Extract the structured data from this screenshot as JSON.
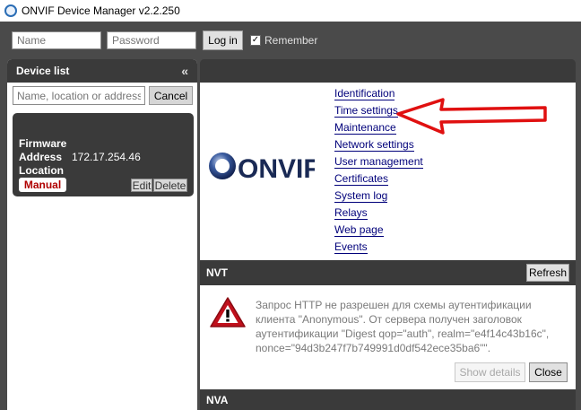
{
  "window": {
    "title": "ONVIF Device Manager v2.2.250"
  },
  "login": {
    "name_placeholder": "Name",
    "password_placeholder": "Password",
    "login_label": "Log in",
    "remember_label": "Remember",
    "remember_checked": true
  },
  "device_list": {
    "title": "Device list",
    "search_placeholder": "Name, location or address",
    "cancel_label": "Cancel",
    "device": {
      "firmware_label": "Firmware",
      "address_label": "Address",
      "address_value": "172.17.254.46",
      "location_label": "Location",
      "badge_label": "Manual",
      "edit_label": "Edit",
      "delete_label": "Delete"
    }
  },
  "main": {
    "logo_text": "ONVIF",
    "menu": [
      "Identification",
      "Time settings",
      "Maintenance",
      "Network settings",
      "User management",
      "Certificates",
      "System log",
      "Relays",
      "Web page",
      "Events"
    ],
    "nvt": {
      "title": "NVT",
      "refresh_label": "Refresh",
      "error_message": "Запрос HTTP не разрешен для схемы аутентификации клиента \"Anonymous\". От сервера получен заголовок аутентификации \"Digest qop=\"auth\", realm=\"e4f14c43b16c\", nonce=\"94d3b247f7b749991d0df542ece35ba6\"\".",
      "show_details_label": "Show details",
      "close_label": "Close"
    },
    "nva": {
      "title": "NVA"
    }
  },
  "colors": {
    "panel_dark": "#3a3a3a",
    "background": "#4a4a4a",
    "link": "#00007a",
    "badge_text": "#b00000",
    "annotation_arrow": "#e01010"
  }
}
